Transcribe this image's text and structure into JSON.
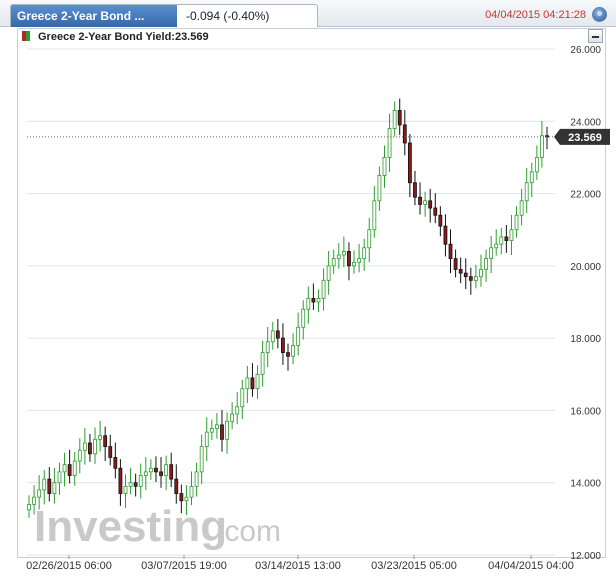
{
  "header": {
    "title": "Greece 2-Year Bond ...",
    "change": "-0.094 (-0.40%)",
    "timestamp": "04/04/2015 04:21:28"
  },
  "legend": {
    "label": "Greece 2-Year Bond Yield:23.569"
  },
  "watermark": {
    "brand": "Investing",
    "suffix": ".com"
  },
  "chart_data": {
    "type": "candlestick",
    "ylim": [
      12,
      26
    ],
    "yticks": [
      "12.000",
      "14.000",
      "16.000",
      "18.000",
      "20.000",
      "22.000",
      "24.000",
      "26.000"
    ],
    "xticks": [
      "02/26/2015 06:00",
      "03/07/2015 19:00",
      "03/14/2015 13:00",
      "03/23/2015 05:00",
      "04/04/2015 04:00"
    ],
    "last_value": 23.569,
    "last_label": "23.569",
    "grid": true,
    "colors": {
      "up": "#2d9d2d",
      "down": "#111111",
      "down_fill": "#8b1a1a"
    },
    "closes": [
      13.4,
      13.6,
      13.8,
      14.1,
      13.7,
      14.0,
      14.3,
      14.5,
      14.2,
      14.6,
      14.9,
      15.1,
      14.8,
      15.2,
      15.3,
      15.0,
      14.7,
      14.4,
      13.7,
      13.9,
      14.0,
      13.9,
      14.2,
      14.3,
      14.4,
      14.3,
      14.2,
      14.5,
      14.1,
      13.7,
      13.5,
      13.6,
      13.9,
      14.3,
      15.0,
      15.4,
      15.5,
      15.6,
      15.2,
      15.7,
      15.9,
      16.1,
      16.6,
      16.9,
      16.6,
      17.0,
      17.6,
      17.9,
      18.2,
      18.0,
      17.6,
      17.5,
      17.8,
      18.3,
      18.8,
      19.1,
      19.0,
      19.1,
      19.6,
      20.0,
      20.2,
      20.3,
      20.4,
      20.0,
      20.1,
      20.2,
      20.5,
      21.0,
      21.8,
      22.5,
      23.0,
      23.8,
      24.3,
      23.9,
      23.4,
      22.3,
      21.9,
      21.7,
      21.8,
      21.6,
      21.4,
      21.1,
      20.6,
      20.2,
      19.9,
      19.8,
      19.7,
      19.6,
      19.7,
      19.9,
      20.2,
      20.5,
      20.6,
      20.8,
      20.7,
      21.0,
      21.4,
      21.8,
      22.3,
      22.6,
      23.0,
      23.6,
      23.569
    ]
  }
}
